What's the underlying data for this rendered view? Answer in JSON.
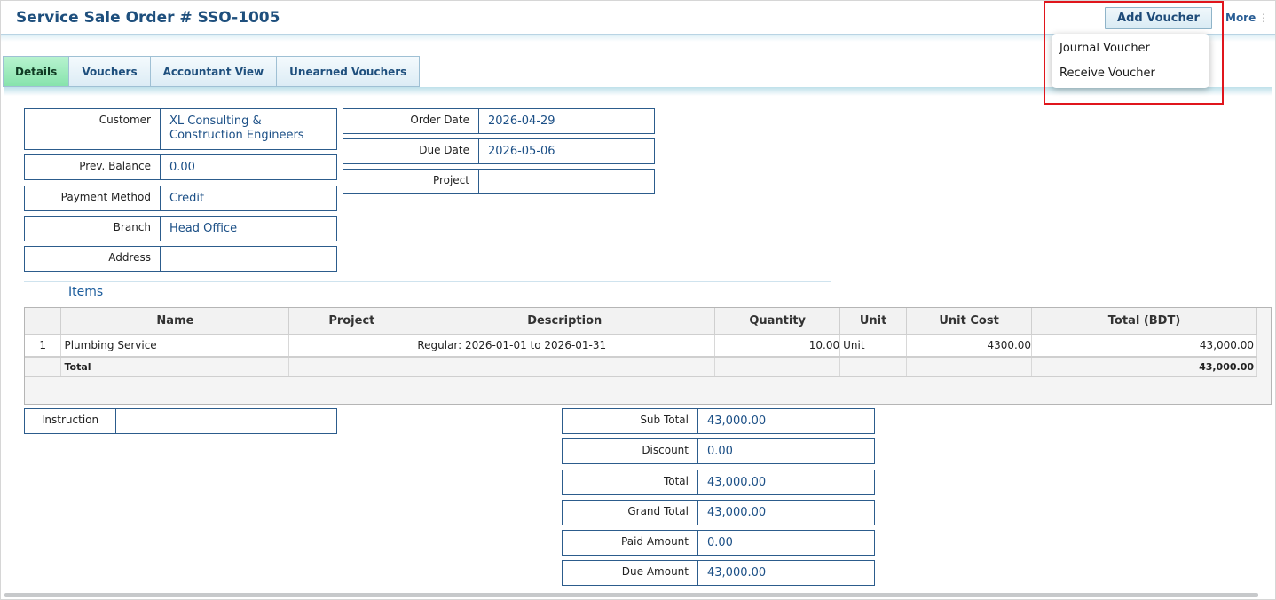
{
  "header": {
    "title": "Service Sale Order # SSO-1005",
    "add_voucher": "Add Voucher",
    "more": "More",
    "more_icon": "⋮",
    "dropdown": [
      "Journal Voucher",
      "Receive Voucher"
    ],
    "highlight_color": "#e0151c"
  },
  "tabs": [
    "Details",
    "Vouchers",
    "Accountant View",
    "Unearned Vouchers"
  ],
  "left_fields": [
    {
      "label": "Customer",
      "value": "XL Consulting & Construction Engineers"
    },
    {
      "label": "Prev. Balance",
      "value": "0.00"
    },
    {
      "label": "Payment Method",
      "value": "Credit"
    },
    {
      "label": "Branch",
      "value": "Head Office"
    },
    {
      "label": "Address",
      "value": ""
    }
  ],
  "right_fields": [
    {
      "label": "Order Date",
      "value": "2026-04-29"
    },
    {
      "label": "Due Date",
      "value": "2026-05-06"
    },
    {
      "label": "Project",
      "value": ""
    }
  ],
  "items": {
    "title": "Items",
    "columns": [
      "",
      "Name",
      "Project",
      "Description",
      "Quantity",
      "Unit",
      "Unit Cost",
      "Total (BDT)"
    ],
    "rows": [
      {
        "no": "1",
        "name": "Plumbing Service",
        "project": "",
        "description": "Regular: 2026-01-01 to 2026-01-31",
        "quantity": "10.00",
        "unit": "Unit",
        "unit_cost": "4300.00",
        "total": "43,000.00"
      }
    ],
    "total_label": "Total",
    "total_value": "43,000.00"
  },
  "instruction": {
    "label": "Instruction",
    "value": ""
  },
  "summary": [
    {
      "label": "Sub Total",
      "value": "43,000.00"
    },
    {
      "label": "Discount",
      "value": "0.00"
    },
    {
      "label": "Total",
      "value": "43,000.00"
    },
    {
      "label": "Grand Total",
      "value": "43,000.00"
    },
    {
      "label": "Paid Amount",
      "value": "0.00"
    },
    {
      "label": "Due Amount",
      "value": "43,000.00"
    }
  ]
}
